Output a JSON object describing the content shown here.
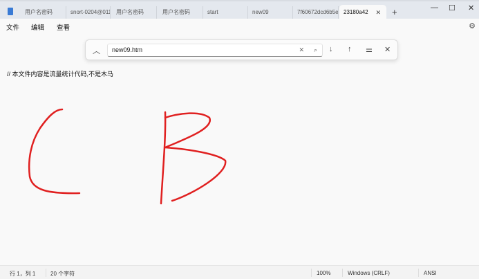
{
  "tabs": [
    "用户名密码",
    "snort-0204@011",
    "用户名密码",
    "用户名密码",
    "start",
    "new09",
    "7f60672dcd6b5e",
    "23180a42"
  ],
  "menu": {
    "file": "文件",
    "edit": "编辑",
    "view": "查看"
  },
  "find": {
    "value": "new09.htm"
  },
  "document": {
    "text": "// 本文件内容是流量统计代码,不是木马"
  },
  "status": {
    "position": "行 1，列 1",
    "chars": "20 个字符",
    "zoom": "100%",
    "line_ending": "Windows (CRLF)",
    "encoding": "ANSI"
  },
  "ink_color": "#e02020"
}
